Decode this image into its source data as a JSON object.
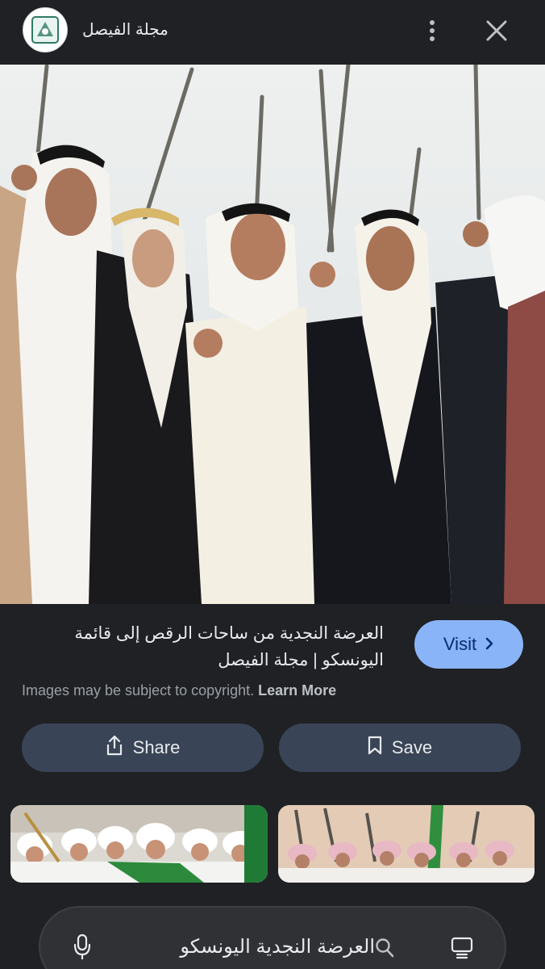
{
  "header": {
    "site_name": "مجلة الفيصل",
    "logo_icon": "magazine-logo-icon",
    "more_icon": "more-vert-icon",
    "close_icon": "close-icon"
  },
  "image": {
    "subject": "photo"
  },
  "result": {
    "title": "العرضة النجدية من ساحات الرقص إلى قائمة اليونسكو | مجلة الفيصل",
    "visit_label": "Visit",
    "copyright_text": "Images may be subject to copyright.",
    "learn_more_label": "Learn More"
  },
  "actions": {
    "share_label": "Share",
    "save_label": "Save"
  },
  "search": {
    "query": "العرضة النجدية اليونسكو",
    "mic_icon": "mic-icon",
    "search_icon": "search-icon",
    "lens_icon": "lens-icon"
  },
  "colors": {
    "background": "#202124",
    "accent": "#8ab4f8",
    "button_bg": "#394457"
  }
}
